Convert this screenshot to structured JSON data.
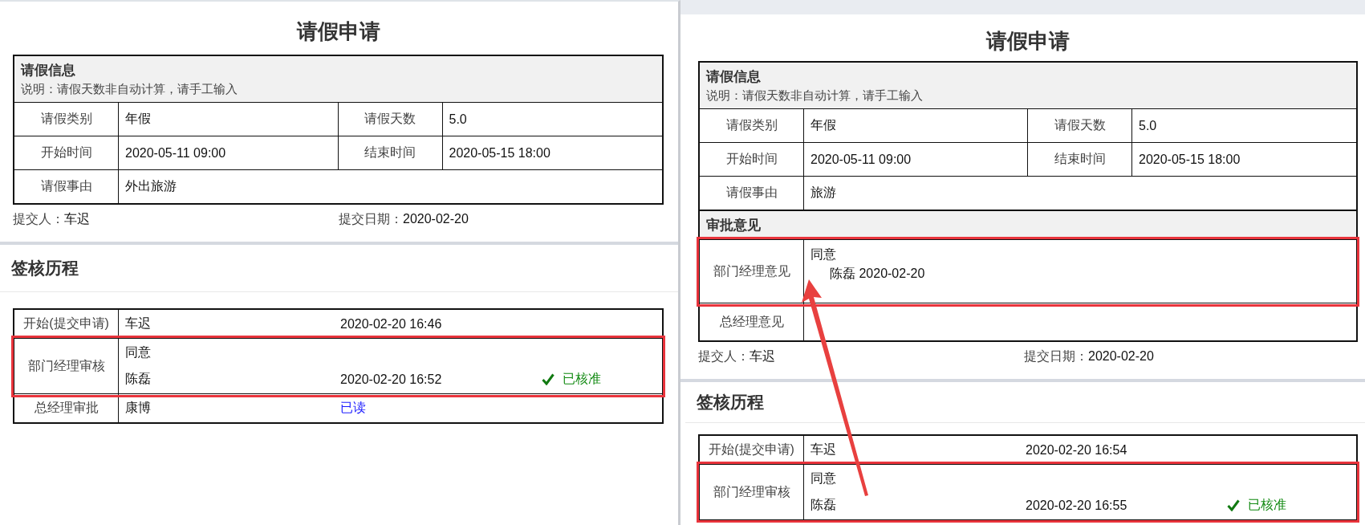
{
  "panels": [
    {
      "title": "请假申请",
      "info_section": {
        "heading": "请假信息",
        "note": "说明：请假天数非自动计算，请手工输入",
        "rows": [
          {
            "cells": [
              {
                "label": "请假类别",
                "value": "年假"
              },
              {
                "label": "请假天数",
                "value": "5.0"
              }
            ]
          },
          {
            "cells": [
              {
                "label": "开始时间",
                "value": "2020-05-11 09:00"
              },
              {
                "label": "结束时间",
                "value": "2020-05-15 18:00"
              }
            ]
          },
          {
            "cells": [
              {
                "label": "请假事由",
                "value": "外出旅游"
              }
            ]
          }
        ]
      },
      "submitter": {
        "label": "提交人：",
        "value": "车迟"
      },
      "submit_date": {
        "label": "提交日期：",
        "value": "2020-02-20"
      },
      "history": {
        "heading": "签核历程",
        "rows": [
          {
            "step": "开始(提交申请)",
            "highlighted": false,
            "lines": [
              {
                "name": "车迟",
                "time": "2020-02-20 16:46"
              }
            ]
          },
          {
            "step": "部门经理审核",
            "highlighted": true,
            "comment": "同意",
            "lines": [
              {
                "name": "陈磊",
                "time": "2020-02-20 16:52",
                "status": {
                  "kind": "approved",
                  "text": "已核准"
                }
              }
            ]
          },
          {
            "step": "总经理审批",
            "highlighted": false,
            "lines": [
              {
                "name": "康博",
                "status": {
                  "kind": "read",
                  "text": "已读"
                }
              }
            ]
          }
        ]
      }
    },
    {
      "title": "请假申请",
      "info_section": {
        "heading": "请假信息",
        "note": "说明：请假天数非自动计算，请手工输入",
        "rows": [
          {
            "cells": [
              {
                "label": "请假类别",
                "value": "年假"
              },
              {
                "label": "请假天数",
                "value": "5.0"
              }
            ]
          },
          {
            "cells": [
              {
                "label": "开始时间",
                "value": "2020-05-11 09:00"
              },
              {
                "label": "结束时间",
                "value": "2020-05-15 18:00"
              }
            ]
          },
          {
            "cells": [
              {
                "label": "请假事由",
                "value": "旅游"
              }
            ]
          }
        ]
      },
      "approval_section": {
        "heading": "审批意见",
        "rows": [
          {
            "label": "部门经理意见",
            "highlighted": true,
            "opinion": "同意",
            "signature": "陈磊 2020-02-20"
          },
          {
            "label": "总经理意见",
            "highlighted": false
          }
        ]
      },
      "submitter": {
        "label": "提交人：",
        "value": "车迟"
      },
      "submit_date": {
        "label": "提交日期：",
        "value": "2020-02-20"
      },
      "history": {
        "heading": "签核历程",
        "rows": [
          {
            "step": "开始(提交申请)",
            "highlighted": false,
            "lines": [
              {
                "name": "车迟",
                "time": "2020-02-20 16:54"
              }
            ]
          },
          {
            "step": "部门经理审核",
            "highlighted": true,
            "comment": "同意",
            "lines": [
              {
                "name": "陈磊",
                "time": "2020-02-20 16:55",
                "status": {
                  "kind": "approved",
                  "text": "已核准"
                }
              }
            ]
          }
        ]
      }
    }
  ]
}
